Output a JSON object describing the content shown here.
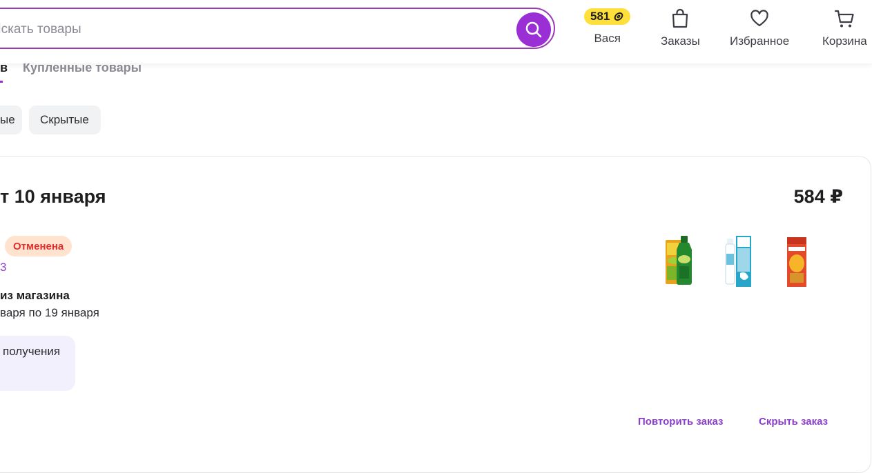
{
  "header": {
    "search_placeholder": "Искать товары",
    "points": "581",
    "nav": {
      "profile_label": "Вася",
      "orders_label": "Заказы",
      "favorites_label": "Избранное",
      "cart_label": "Корзина"
    }
  },
  "tabs": {
    "active_partial": "в",
    "purchased_label": "Купленные товары"
  },
  "filters": {
    "chip_partial": "ые",
    "hidden_label": "Скрытые"
  },
  "order": {
    "title": "т 10 января",
    "price": "584 ₽",
    "status": "Отменена",
    "number_partial": "3",
    "delivery_type": "из магазина",
    "delivery_dates": "варя по 19 января",
    "pickup_text": "получения",
    "products": [
      {
        "icon": "aloe-juice-bottle-icon"
      },
      {
        "icon": "nasal-spray-icon"
      },
      {
        "icon": "syrup-box-icon"
      }
    ],
    "repeat_label": "Повторить заказ",
    "hide_label": "Скрыть заказ"
  },
  "colors": {
    "accent": "#9a2fd6",
    "link": "#8b3fc8",
    "status_bg": "#ffe3cf",
    "status_text": "#e12e2e",
    "points_bg": "#ffdf3a"
  }
}
